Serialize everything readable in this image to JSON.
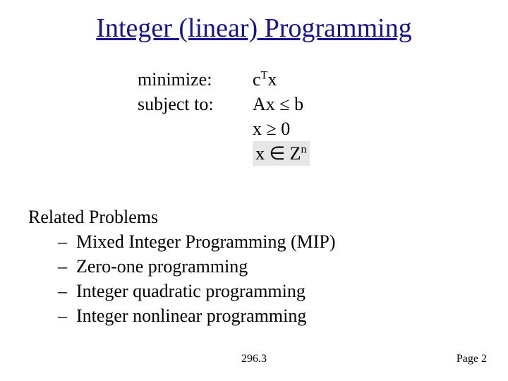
{
  "title": "Integer (linear) Programming",
  "formulation": {
    "minimize_label": "minimize:",
    "subject_label": "subject to:",
    "objective_c": "c",
    "objective_T": "T",
    "objective_x": "x",
    "constr_left": "Ax ",
    "constr_le": "≤",
    "constr_right": " b",
    "nonneg_left": "x ",
    "nonneg_ge": "≥",
    "nonneg_right": " 0",
    "int_left": "x ",
    "int_in": "∈",
    "int_set": " Z",
    "int_sup": "n"
  },
  "related": {
    "heading": "Related Problems",
    "items": [
      "Mixed Integer Programming (MIP)",
      "Zero-one programming",
      "Integer quadratic programming",
      "Integer nonlinear programming"
    ]
  },
  "footer": {
    "center": "296.3",
    "right": "Page 2"
  }
}
